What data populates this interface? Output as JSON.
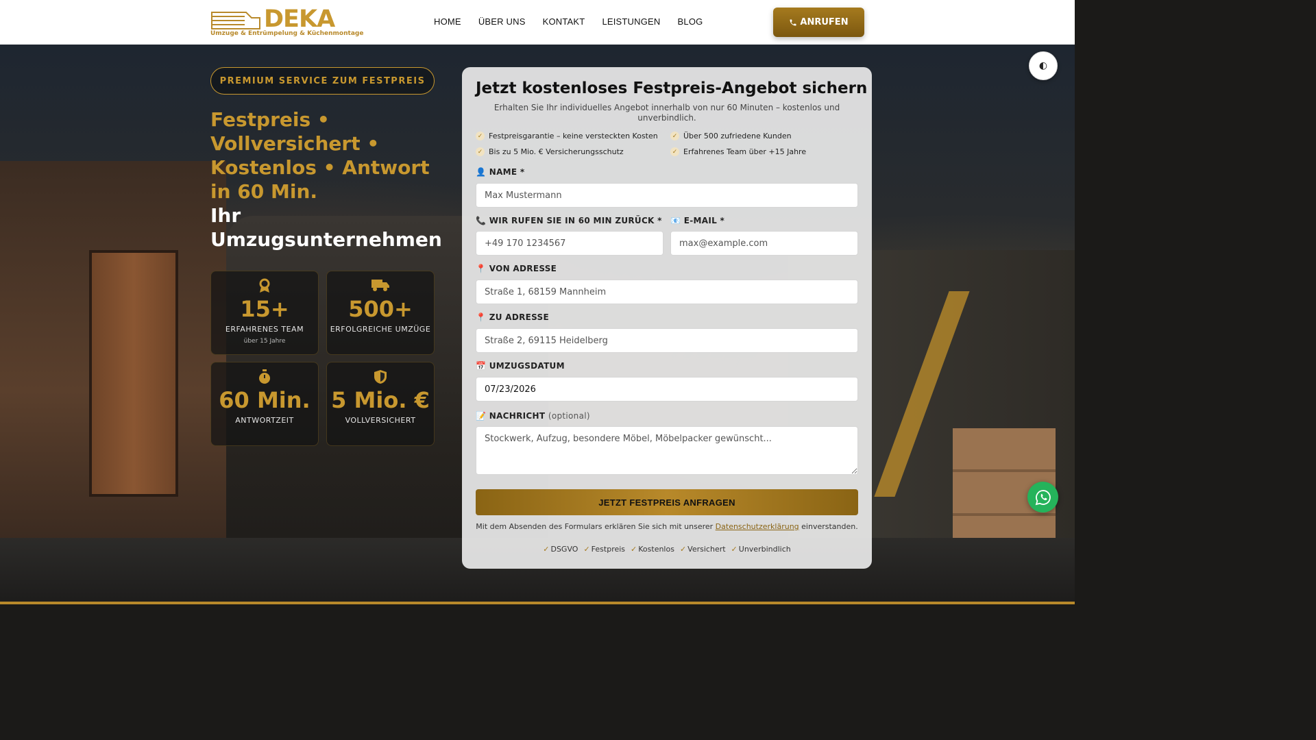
{
  "brand": {
    "name": "DEKA",
    "tagline": "Umzuge & Entrümpelung & Küchenmontage",
    "gold": "#c8982f"
  },
  "nav": {
    "items": [
      "HOME",
      "ÜBER UNS",
      "KONTAKT",
      "LEISTUNGEN",
      "BLOG"
    ],
    "call_label": "ANRUFEN",
    "call_icon": "phone-icon"
  },
  "hero": {
    "badge": "PREMIUM SERVICE ZUM FESTPREIS",
    "headline_gold": [
      "Festpreis •",
      "Vollversichert •",
      "Kostenlos • Antwort",
      "in 60 Min."
    ],
    "headline_white": [
      "Ihr",
      "Umzugsunternehmen"
    ]
  },
  "stats": [
    {
      "icon": "award-icon",
      "value": "15+",
      "label": "ERFAHRENES TEAM",
      "sub": "über 15 Jahre"
    },
    {
      "icon": "truck-icon",
      "value": "500+",
      "label": "ERFOLGREICHE UMZÜGE",
      "sub": ""
    },
    {
      "icon": "stopwatch-icon",
      "value": "60 Min.",
      "label": "ANTWORTZEIT",
      "sub": ""
    },
    {
      "icon": "shield-icon",
      "value": "5 Mio. €",
      "label": "VOLLVERSICHERT",
      "sub": ""
    }
  ],
  "form": {
    "title": "Jetzt kostenloses Festpreis-Angebot sichern",
    "subtitle": "Erhalten Sie Ihr individuelles Angebot innerhalb von nur 60 Minuten – kostenlos und unverbindlich.",
    "bullets": [
      "Festpreisgarantie – keine versteckten Kosten",
      "Über 500 zufriedene Kunden",
      "Bis zu 5 Mio. € Versicherungsschutz",
      "Erfahrenes Team über +15 Jahre"
    ],
    "name_label": "NAME *",
    "name_placeholder": "Max Mustermann",
    "phone_label": "WIR RUFEN SIE IN 60 MIN ZURÜCK *",
    "phone_placeholder": "+49 170 1234567",
    "email_label": "E-MAIL *",
    "email_placeholder": "max@example.com",
    "from_label": "VON ADRESSE",
    "from_placeholder": "Straße 1, 68159 Mannheim",
    "to_label": "ZU ADRESSE",
    "to_placeholder": "Straße 2, 69115 Heidelberg",
    "date_label": "UMZUGSDATUM",
    "date_value": "07/23/2026",
    "message_label": "NACHRICHT",
    "message_optional": "(optional)",
    "message_placeholder": "Stockwerk, Aufzug, besondere Möbel, Möbelpacker gewünscht...",
    "submit_label": "JETZT FESTPREIS ANFRAGEN",
    "privacy_before": "Mit dem Absenden des Formulars erklären Sie sich mit unserer",
    "privacy_link": "Datenschutzerklärung",
    "privacy_after": "einverstanden.",
    "trust": [
      "DSGVO",
      "Festpreis",
      "Kostenlos",
      "Versichert",
      "Unverbindlich"
    ]
  },
  "floating": {
    "theme_icon": "contrast-icon",
    "chat_icon": "whatsapp-icon"
  }
}
